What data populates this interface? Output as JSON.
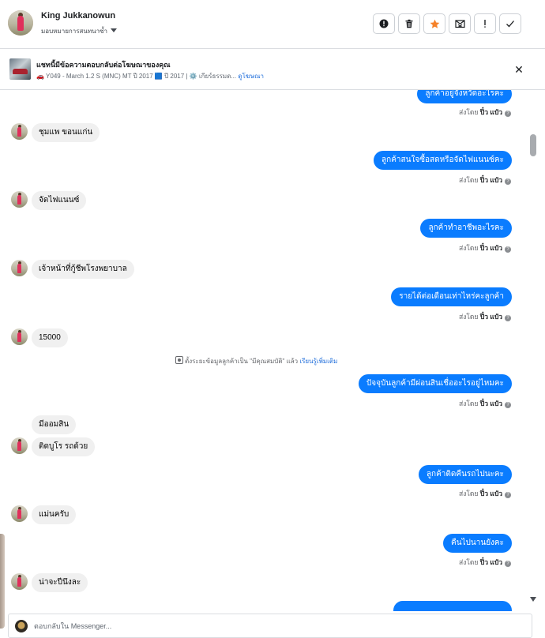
{
  "header": {
    "user_name": "King Jukkanowun",
    "assign_label": "มอบหมายการสนทนาซ้ำ",
    "actions": [
      {
        "name": "spam-button",
        "icon": "alert-circle-icon"
      },
      {
        "name": "delete-button",
        "icon": "trash-icon"
      },
      {
        "name": "star-button",
        "icon": "star-icon",
        "color": "#f5822a"
      },
      {
        "name": "mark-unread-button",
        "icon": "envelope-x-icon"
      },
      {
        "name": "follow-up-button",
        "icon": "exclamation-icon"
      },
      {
        "name": "done-button",
        "icon": "check-icon"
      }
    ]
  },
  "ad": {
    "title": "แชทนี้มีข้อความตอบกลับต่อโฆษณาของคุณ",
    "meta": "🚗 Y049 - March 1.2 S (MNC) MT ปี 2017 🟦 ปี 2017 | ⚙️ เกียร์ธรรมด...",
    "link": "ดูโฆษณา"
  },
  "conversation": {
    "sent_by_prefix": "ส่งโดย",
    "agent": "ปิ๋ว แป๋ว",
    "messages": [
      {
        "dir": "out",
        "text": "ลูกค้าอยู่จังหวัดอะไรคะ",
        "sent": true
      },
      {
        "dir": "in",
        "text": "ชุมแพ ขอนแก่น",
        "avatar": true
      },
      {
        "dir": "out",
        "text": "ลูกค้าสนใจซื้อสดหรือจัดไฟแนนซ์คะ",
        "sent": true
      },
      {
        "dir": "in",
        "text": "จัดไฟแนนซ์",
        "avatar": true
      },
      {
        "dir": "out",
        "text": "ลูกค้าทำอาชีพอะไรคะ",
        "sent": true
      },
      {
        "dir": "in",
        "text": "เจ้าหน้าที่กู้ชีพโรงพยาบาล",
        "avatar": true
      },
      {
        "dir": "out",
        "text": "รายได้ต่อเดือนเท่าไหร่คะลูกค้า",
        "sent": true
      },
      {
        "dir": "in",
        "text": "15000",
        "avatar": true
      },
      {
        "dir": "out",
        "text": "ปัจจุบันลูกค้ามีผ่อนสินเชื่ออะไรอยู่ไหมคะ",
        "sent": true
      },
      {
        "dir": "in",
        "text": "มีออมสิน",
        "avatar": false
      },
      {
        "dir": "in",
        "text": "ติดบูโร รถด้วย",
        "avatar": true
      },
      {
        "dir": "out",
        "text": "ลูกค้าติดคืนรถไปนะคะ",
        "sent": true
      },
      {
        "dir": "in",
        "text": "แม่นครับ",
        "avatar": true
      },
      {
        "dir": "out",
        "text": "คืนไปนานยังคะ",
        "sent": true
      },
      {
        "dir": "in",
        "text": "น่าจะปีนึงละ",
        "avatar": true
      }
    ],
    "system_note": {
      "text": "ตั้งระยะข้อมูลลูกค้าเป็น \"มีคุณสมบัติ\" แล้ว",
      "link": "เรียนรู้เพิ่มเติม"
    }
  },
  "composer": {
    "placeholder": "ตอบกลับใน Messenger..."
  }
}
